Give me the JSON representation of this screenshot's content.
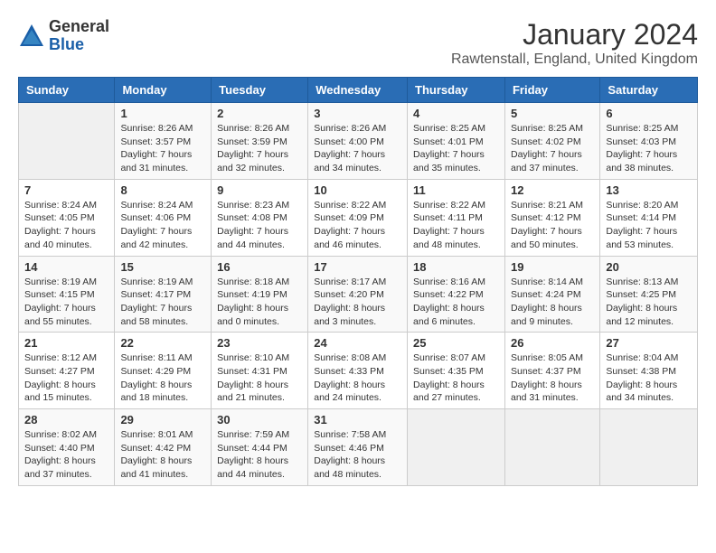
{
  "logo": {
    "general": "General",
    "blue": "Blue"
  },
  "title": "January 2024",
  "location": "Rawtenstall, England, United Kingdom",
  "headers": [
    "Sunday",
    "Monday",
    "Tuesday",
    "Wednesday",
    "Thursday",
    "Friday",
    "Saturday"
  ],
  "weeks": [
    [
      {
        "day": "",
        "sunrise": "",
        "sunset": "",
        "daylight": ""
      },
      {
        "day": "1",
        "sunrise": "Sunrise: 8:26 AM",
        "sunset": "Sunset: 3:57 PM",
        "daylight": "Daylight: 7 hours and 31 minutes."
      },
      {
        "day": "2",
        "sunrise": "Sunrise: 8:26 AM",
        "sunset": "Sunset: 3:59 PM",
        "daylight": "Daylight: 7 hours and 32 minutes."
      },
      {
        "day": "3",
        "sunrise": "Sunrise: 8:26 AM",
        "sunset": "Sunset: 4:00 PM",
        "daylight": "Daylight: 7 hours and 34 minutes."
      },
      {
        "day": "4",
        "sunrise": "Sunrise: 8:25 AM",
        "sunset": "Sunset: 4:01 PM",
        "daylight": "Daylight: 7 hours and 35 minutes."
      },
      {
        "day": "5",
        "sunrise": "Sunrise: 8:25 AM",
        "sunset": "Sunset: 4:02 PM",
        "daylight": "Daylight: 7 hours and 37 minutes."
      },
      {
        "day": "6",
        "sunrise": "Sunrise: 8:25 AM",
        "sunset": "Sunset: 4:03 PM",
        "daylight": "Daylight: 7 hours and 38 minutes."
      }
    ],
    [
      {
        "day": "7",
        "sunrise": "Sunrise: 8:24 AM",
        "sunset": "Sunset: 4:05 PM",
        "daylight": "Daylight: 7 hours and 40 minutes."
      },
      {
        "day": "8",
        "sunrise": "Sunrise: 8:24 AM",
        "sunset": "Sunset: 4:06 PM",
        "daylight": "Daylight: 7 hours and 42 minutes."
      },
      {
        "day": "9",
        "sunrise": "Sunrise: 8:23 AM",
        "sunset": "Sunset: 4:08 PM",
        "daylight": "Daylight: 7 hours and 44 minutes."
      },
      {
        "day": "10",
        "sunrise": "Sunrise: 8:22 AM",
        "sunset": "Sunset: 4:09 PM",
        "daylight": "Daylight: 7 hours and 46 minutes."
      },
      {
        "day": "11",
        "sunrise": "Sunrise: 8:22 AM",
        "sunset": "Sunset: 4:11 PM",
        "daylight": "Daylight: 7 hours and 48 minutes."
      },
      {
        "day": "12",
        "sunrise": "Sunrise: 8:21 AM",
        "sunset": "Sunset: 4:12 PM",
        "daylight": "Daylight: 7 hours and 50 minutes."
      },
      {
        "day": "13",
        "sunrise": "Sunrise: 8:20 AM",
        "sunset": "Sunset: 4:14 PM",
        "daylight": "Daylight: 7 hours and 53 minutes."
      }
    ],
    [
      {
        "day": "14",
        "sunrise": "Sunrise: 8:19 AM",
        "sunset": "Sunset: 4:15 PM",
        "daylight": "Daylight: 7 hours and 55 minutes."
      },
      {
        "day": "15",
        "sunrise": "Sunrise: 8:19 AM",
        "sunset": "Sunset: 4:17 PM",
        "daylight": "Daylight: 7 hours and 58 minutes."
      },
      {
        "day": "16",
        "sunrise": "Sunrise: 8:18 AM",
        "sunset": "Sunset: 4:19 PM",
        "daylight": "Daylight: 8 hours and 0 minutes."
      },
      {
        "day": "17",
        "sunrise": "Sunrise: 8:17 AM",
        "sunset": "Sunset: 4:20 PM",
        "daylight": "Daylight: 8 hours and 3 minutes."
      },
      {
        "day": "18",
        "sunrise": "Sunrise: 8:16 AM",
        "sunset": "Sunset: 4:22 PM",
        "daylight": "Daylight: 8 hours and 6 minutes."
      },
      {
        "day": "19",
        "sunrise": "Sunrise: 8:14 AM",
        "sunset": "Sunset: 4:24 PM",
        "daylight": "Daylight: 8 hours and 9 minutes."
      },
      {
        "day": "20",
        "sunrise": "Sunrise: 8:13 AM",
        "sunset": "Sunset: 4:25 PM",
        "daylight": "Daylight: 8 hours and 12 minutes."
      }
    ],
    [
      {
        "day": "21",
        "sunrise": "Sunrise: 8:12 AM",
        "sunset": "Sunset: 4:27 PM",
        "daylight": "Daylight: 8 hours and 15 minutes."
      },
      {
        "day": "22",
        "sunrise": "Sunrise: 8:11 AM",
        "sunset": "Sunset: 4:29 PM",
        "daylight": "Daylight: 8 hours and 18 minutes."
      },
      {
        "day": "23",
        "sunrise": "Sunrise: 8:10 AM",
        "sunset": "Sunset: 4:31 PM",
        "daylight": "Daylight: 8 hours and 21 minutes."
      },
      {
        "day": "24",
        "sunrise": "Sunrise: 8:08 AM",
        "sunset": "Sunset: 4:33 PM",
        "daylight": "Daylight: 8 hours and 24 minutes."
      },
      {
        "day": "25",
        "sunrise": "Sunrise: 8:07 AM",
        "sunset": "Sunset: 4:35 PM",
        "daylight": "Daylight: 8 hours and 27 minutes."
      },
      {
        "day": "26",
        "sunrise": "Sunrise: 8:05 AM",
        "sunset": "Sunset: 4:37 PM",
        "daylight": "Daylight: 8 hours and 31 minutes."
      },
      {
        "day": "27",
        "sunrise": "Sunrise: 8:04 AM",
        "sunset": "Sunset: 4:38 PM",
        "daylight": "Daylight: 8 hours and 34 minutes."
      }
    ],
    [
      {
        "day": "28",
        "sunrise": "Sunrise: 8:02 AM",
        "sunset": "Sunset: 4:40 PM",
        "daylight": "Daylight: 8 hours and 37 minutes."
      },
      {
        "day": "29",
        "sunrise": "Sunrise: 8:01 AM",
        "sunset": "Sunset: 4:42 PM",
        "daylight": "Daylight: 8 hours and 41 minutes."
      },
      {
        "day": "30",
        "sunrise": "Sunrise: 7:59 AM",
        "sunset": "Sunset: 4:44 PM",
        "daylight": "Daylight: 8 hours and 44 minutes."
      },
      {
        "day": "31",
        "sunrise": "Sunrise: 7:58 AM",
        "sunset": "Sunset: 4:46 PM",
        "daylight": "Daylight: 8 hours and 48 minutes."
      },
      {
        "day": "",
        "sunrise": "",
        "sunset": "",
        "daylight": ""
      },
      {
        "day": "",
        "sunrise": "",
        "sunset": "",
        "daylight": ""
      },
      {
        "day": "",
        "sunrise": "",
        "sunset": "",
        "daylight": ""
      }
    ]
  ]
}
